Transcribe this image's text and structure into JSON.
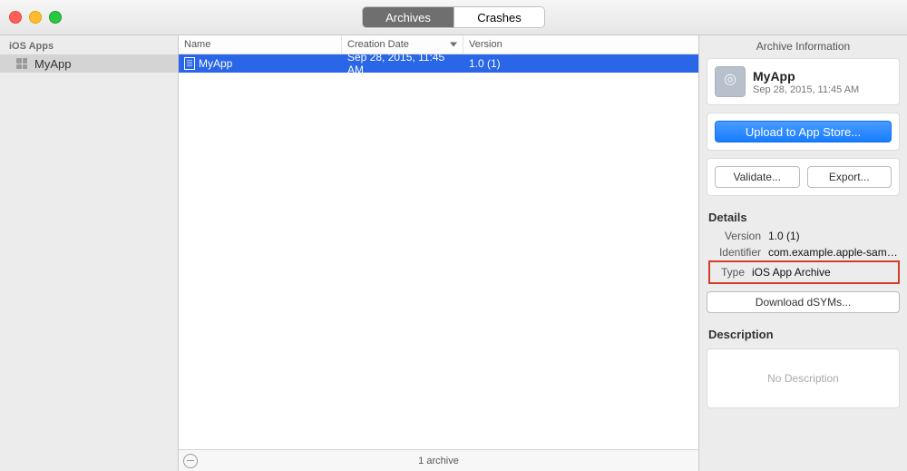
{
  "tabs": {
    "archives": "Archives",
    "crashes": "Crashes"
  },
  "sidebar": {
    "header": "iOS Apps",
    "items": [
      {
        "label": "MyApp"
      }
    ]
  },
  "columns": {
    "name": "Name",
    "creation_date": "Creation Date",
    "version": "Version"
  },
  "rows": [
    {
      "name": "MyApp",
      "date": "Sep 28, 2015, 11:45 AM",
      "version": "1.0 (1)"
    }
  ],
  "footer": {
    "count_text": "1 archive"
  },
  "inspector": {
    "title": "Archive Information",
    "archive": {
      "name": "MyApp",
      "date": "Sep 28, 2015, 11:45 AM"
    },
    "buttons": {
      "upload": "Upload to App Store...",
      "validate": "Validate...",
      "export": "Export..."
    },
    "details_label": "Details",
    "details": {
      "version_k": "Version",
      "version_v": "1.0 (1)",
      "identifier_k": "Identifier",
      "identifier_v": "com.example.apple-sam…",
      "type_k": "Type",
      "type_v": "iOS App Archive"
    },
    "download_dsyms": "Download dSYMs...",
    "description_label": "Description",
    "description_placeholder": "No Description"
  }
}
